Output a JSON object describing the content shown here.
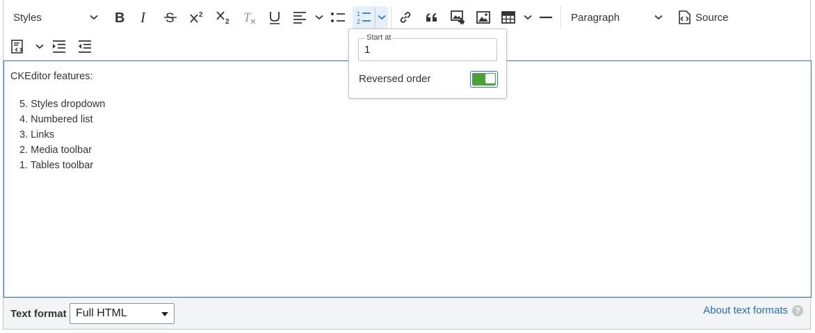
{
  "toolbar": {
    "styles_label": "Styles",
    "heading_label": "Paragraph",
    "source_label": "Source",
    "tools": [
      "bold-icon",
      "italic-icon",
      "strikethrough-icon",
      "superscript-icon",
      "subscript-icon",
      "remove-format-icon",
      "underline-icon",
      "align-icon",
      "bulleted-list-icon",
      "numbered-list-icon",
      "link-icon",
      "blockquote-icon",
      "media-icon",
      "image-icon",
      "table-icon",
      "horizontal-line-icon",
      "code-block-icon",
      "indent-icon",
      "outdent-icon"
    ],
    "accent_color": "#2977cd"
  },
  "list_properties": {
    "start_at_label": "Start at",
    "start_at_value": "1",
    "reversed_label": "Reversed order",
    "reversed_on": true,
    "toggle_color": "#4aa236"
  },
  "content": {
    "intro": "CKEditor features:",
    "items": [
      "5. Styles dropdown",
      "4. Numbered list",
      "3. Links",
      "2. Media toolbar",
      "1. Tables toolbar"
    ]
  },
  "footer": {
    "format_label": "Text format",
    "format_value": "Full HTML",
    "about_link": "About text formats"
  }
}
